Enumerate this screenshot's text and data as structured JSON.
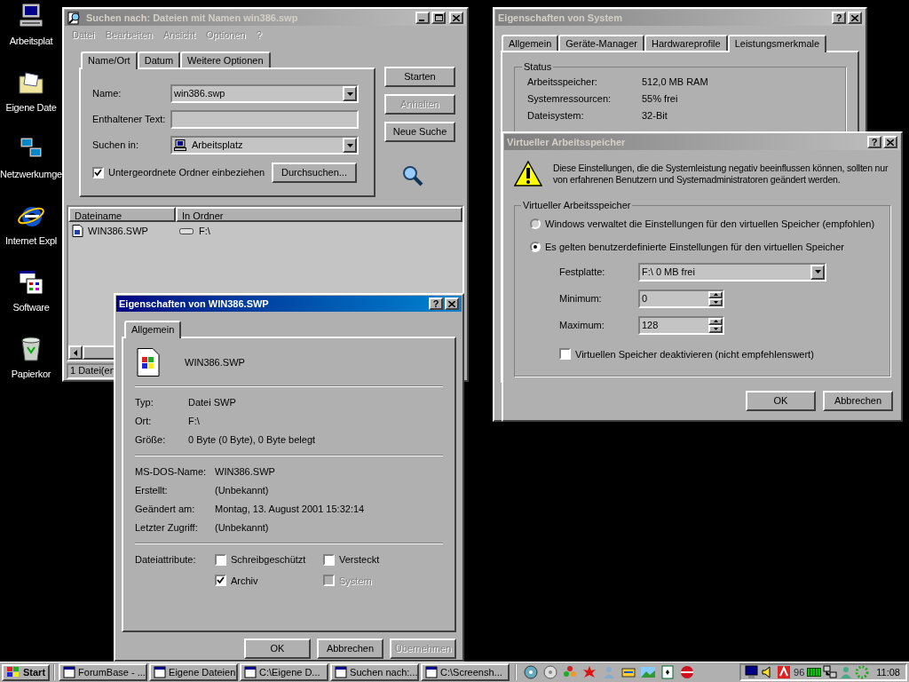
{
  "desktop_icons": [
    {
      "label": "Arbeitsplat",
      "kind": "computer"
    },
    {
      "label": "Eigene Date",
      "kind": "folder"
    },
    {
      "label": "Netzwerkumge",
      "kind": "network"
    },
    {
      "label": "Internet Expl",
      "kind": "browser"
    },
    {
      "label": "Software",
      "kind": "software"
    },
    {
      "label": "Papierkor",
      "kind": "trash"
    }
  ],
  "search_window": {
    "title": "Suchen nach: Dateien mit Namen win386.swp",
    "active": false,
    "menu": [
      {
        "label": "Datei",
        "disabled": true
      },
      {
        "label": "Bearbeiten",
        "disabled": true
      },
      {
        "label": "Ansicht",
        "disabled": true
      },
      {
        "label": "Optionen",
        "disabled": true
      },
      {
        "label": "?",
        "disabled": true
      }
    ],
    "tabs": [
      {
        "label": "Name/Ort",
        "selected": true
      },
      {
        "label": "Datum",
        "selected": false
      },
      {
        "label": "Weitere Optionen",
        "selected": false
      }
    ],
    "name_label": "Name:",
    "name_value": "win386.swp",
    "text_label": "Enthaltener Text:",
    "location_label": "Suchen in:",
    "location_value": "Arbeitsplatz",
    "subfolders": {
      "label": "Untergeordnete Ordner einbeziehen",
      "checked": true
    },
    "browse_button": "Durchsuchen...",
    "buttons": [
      {
        "label": "Starten",
        "disabled": false
      },
      {
        "label": "Anhalten",
        "disabled": true
      },
      {
        "label": "Neue Suche",
        "disabled": false
      }
    ],
    "columns": [
      "Dateiname",
      "In Ordner"
    ],
    "rows": [
      {
        "name": "WIN386.SWP",
        "folder": "F:\\"
      }
    ],
    "status": "1 Datei(en"
  },
  "system_properties": {
    "title": "Eigenschaften von System",
    "active": false,
    "help_button": "?",
    "tabs": [
      {
        "label": "Allgemein",
        "selected": false
      },
      {
        "label": "Geräte-Manager",
        "selected": false
      },
      {
        "label": "Hardwareprofile",
        "selected": false
      },
      {
        "label": "Leistungsmerkmale",
        "selected": true
      }
    ],
    "group": "Status",
    "rows": [
      {
        "label": "Arbeitsspeicher:",
        "value": "512,0 MB RAM"
      },
      {
        "label": "Systemressourcen:",
        "value": "55% frei"
      },
      {
        "label": "Dateisystem:",
        "value": "32-Bit"
      }
    ]
  },
  "virtual_memory": {
    "title": "Virtueller Arbeitsspeicher",
    "active": false,
    "help_button": "?",
    "warning": "Diese Einstellungen, die die Systemleistung negativ beeinflussen können, sollten nur von erfahrenen Benutzern und Systemadministratoren geändert werden.",
    "group": "Virtueller Arbeitsspeicher",
    "options": [
      {
        "label": "Windows verwaltet die Einstellungen für den virtuellen Speicher (empfohlen)",
        "selected": false
      },
      {
        "label": "Es gelten benutzerdefinierte Einstellungen für den virtuellen Speicher",
        "selected": true
      }
    ],
    "disk_label": "Festplatte:",
    "disk_value": "F:\\ 0 MB frei",
    "minimum_label": "Minimum:",
    "minimum_value": "0",
    "maximum_label": "Maximum:",
    "maximum_value": "128",
    "disable": {
      "label": "Virtuellen Speicher deaktivieren (nicht empfehlenswert)",
      "checked": false
    },
    "buttons": [
      {
        "label": "OK",
        "disabled": false
      },
      {
        "label": "Abbrechen",
        "disabled": false
      }
    ]
  },
  "file_properties": {
    "title": "Eigenschaften von WIN386.SWP",
    "active": true,
    "help_button": "?",
    "tab": {
      "label": "Allgemein",
      "selected": true
    },
    "file_name": "WIN386.SWP",
    "details": [
      {
        "label": "Typ:",
        "value": "Datei SWP"
      },
      {
        "label": "Ort:",
        "value": "F:\\"
      },
      {
        "label": "Größe:",
        "value": "0 Byte (0 Byte), 0 Byte belegt"
      }
    ],
    "dates": [
      {
        "label": "MS-DOS-Name:",
        "value": "WIN386.SWP"
      },
      {
        "label": "Erstellt:",
        "value": "(Unbekannt)"
      },
      {
        "label": "Geändert am:",
        "value": "Montag, 13. August 2001 15:32:14"
      },
      {
        "label": "Letzter Zugriff:",
        "value": "(Unbekannt)"
      }
    ],
    "attributes_label": "Dateiattribute:",
    "attributes": [
      {
        "label": "Schreibgeschützt",
        "checked": false,
        "disabled": false
      },
      {
        "label": "Versteckt",
        "checked": false,
        "disabled": false
      },
      {
        "label": "Archiv",
        "checked": true,
        "disabled": false
      },
      {
        "label": "System",
        "checked": false,
        "disabled": true
      }
    ],
    "buttons": [
      {
        "label": "OK",
        "disabled": false
      },
      {
        "label": "Abbrechen",
        "disabled": false
      },
      {
        "label": "Übernehmen",
        "disabled": true
      }
    ]
  },
  "taskbar": {
    "start": "Start",
    "tasks": [
      {
        "label": "ForumBase - ..."
      },
      {
        "label": "Eigene Dateien"
      },
      {
        "label": "C:\\Eigene D..."
      },
      {
        "label": "Suchen nach:..."
      },
      {
        "label": "C:\\Screensh..."
      }
    ],
    "tray_text": "96",
    "clock": "11:08"
  }
}
